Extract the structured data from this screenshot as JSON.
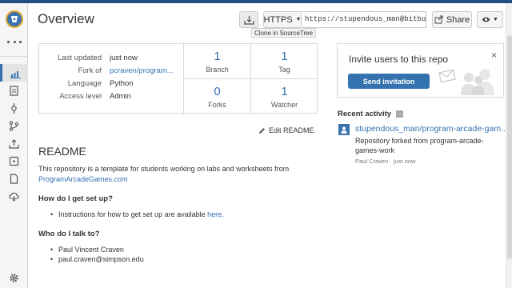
{
  "header": {
    "title": "Overview",
    "clone_tooltip": "Clone in SourceTree",
    "protocol": "HTTPS",
    "clone_url": "https://stupendous_man@bitbucket.org/stupendous_man/program-arcade-games.git",
    "share_label": "Share"
  },
  "repo_info": {
    "last_updated_label": "Last updated",
    "last_updated_value": "just now",
    "fork_of_label": "Fork of",
    "fork_of_value": "pcraven/program...",
    "language_label": "Language",
    "language_value": "Python",
    "access_label": "Access level",
    "access_value": "Admin"
  },
  "stats": {
    "branch_count": "1",
    "branch_label": "Branch",
    "tag_count": "1",
    "tag_label": "Tag",
    "forks_count": "0",
    "forks_label": "Forks",
    "watcher_count": "1",
    "watcher_label": "Watcher"
  },
  "edit_readme": "Edit README",
  "readme": {
    "heading": "README",
    "intro": "This repository is a template for students working on labs and worksheets from",
    "intro_link": "ProgramArcadeGames.com",
    "setup_heading": "How do I get set up?",
    "setup_text": "Instructions for how to get set up are available",
    "setup_link": "here.",
    "contact_heading": "Who do I talk to?",
    "contact_name": "Paul Vincent Craven",
    "contact_email": "paul.craven@simpson.edu"
  },
  "invite": {
    "title": "Invite users to this repo",
    "button": "Send invitation",
    "close": "×"
  },
  "activity": {
    "heading": "Recent activity",
    "link": "stupendous_man/program-arcade-gam...",
    "description": "Repository forked from program-arcade-games-work",
    "meta": "Paul Craven · just now"
  },
  "colors": {
    "brand": "#205081",
    "link": "#3572b0",
    "button_primary": "#3572b0"
  },
  "icons": {
    "logo": "bitbucket-logo-icon",
    "clone": "clone-download-icon",
    "share": "share-icon",
    "watch": "eye-icon",
    "edit": "pencil-icon",
    "rss": "rss-icon",
    "settings": "gear-icon"
  }
}
